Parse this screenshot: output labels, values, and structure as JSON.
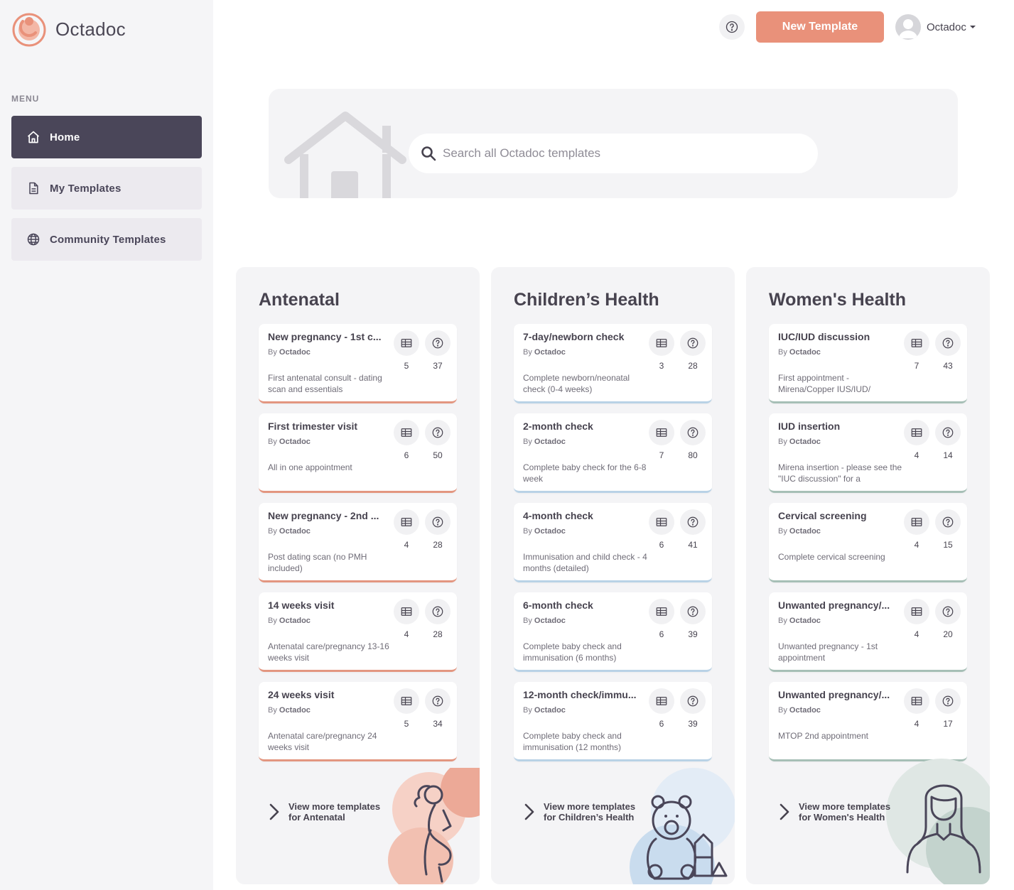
{
  "brand": {
    "name": "Octadoc",
    "accent": "#e9917a",
    "dark": "#4a4659"
  },
  "sidebar": {
    "menu_heading": "MENU",
    "items": [
      {
        "label": "Home",
        "icon": "home-icon",
        "active": true
      },
      {
        "label": "My Templates",
        "icon": "document-icon",
        "active": false
      },
      {
        "label": "Community Templates",
        "icon": "globe-icon",
        "active": false
      }
    ]
  },
  "header": {
    "help_icon": "question-circle-icon",
    "new_template_label": "New Template",
    "user_name": "Octadoc"
  },
  "search": {
    "placeholder": "Search all Octadoc templates",
    "value": ""
  },
  "columns": [
    {
      "title": "Antenatal",
      "accent": "#e39680",
      "view_more": "View more templates for Antenatal",
      "cards": [
        {
          "title": "New pregnancy - 1st c...",
          "by_prefix": "By",
          "author": "Octadoc",
          "fields": "5",
          "questions": "37",
          "desc": "First antenatal consult - dating scan and essentials"
        },
        {
          "title": "First trimester visit",
          "by_prefix": "By",
          "author": "Octadoc",
          "fields": "6",
          "questions": "50",
          "desc": "All in one appointment"
        },
        {
          "title": "New pregnancy - 2nd ...",
          "by_prefix": "By",
          "author": "Octadoc",
          "fields": "4",
          "questions": "28",
          "desc": "Post dating scan (no PMH included)"
        },
        {
          "title": "14 weeks visit",
          "by_prefix": "By",
          "author": "Octadoc",
          "fields": "4",
          "questions": "28",
          "desc": "Antenatal care/pregnancy 13-16 weeks visit"
        },
        {
          "title": "24 weeks visit",
          "by_prefix": "By",
          "author": "Octadoc",
          "fields": "5",
          "questions": "34",
          "desc": "Antenatal care/pregnancy 24 weeks visit"
        }
      ]
    },
    {
      "title": "Children’s Health",
      "accent": "#b9d2e6",
      "view_more": "View more templates for Children’s Health",
      "cards": [
        {
          "title": "7-day/newborn check",
          "by_prefix": "By",
          "author": "Octadoc",
          "fields": "3",
          "questions": "28",
          "desc": "Complete newborn/neonatal check (0-4 weeks)"
        },
        {
          "title": "2-month check",
          "by_prefix": "By",
          "author": "Octadoc",
          "fields": "7",
          "questions": "80",
          "desc": "Complete baby check for the 6-8 week"
        },
        {
          "title": "4-month check",
          "by_prefix": "By",
          "author": "Octadoc",
          "fields": "6",
          "questions": "41",
          "desc": "Immunisation and child check - 4 months (detailed)"
        },
        {
          "title": "6-month check",
          "by_prefix": "By",
          "author": "Octadoc",
          "fields": "6",
          "questions": "39",
          "desc": "Complete baby check and immunisation (6 months)"
        },
        {
          "title": "12-month check/immu...",
          "by_prefix": "By",
          "author": "Octadoc",
          "fields": "6",
          "questions": "39",
          "desc": "Complete baby check and immunisation (12 months)"
        }
      ]
    },
    {
      "title": "Women's Health",
      "accent": "#a6bfb6",
      "view_more": "View more templates for Women's Health",
      "cards": [
        {
          "title": "IUC/IUD discussion",
          "by_prefix": "By",
          "author": "Octadoc",
          "fields": "7",
          "questions": "43",
          "desc": "First appointment - Mirena/Copper IUS/IUD/"
        },
        {
          "title": "IUD insertion",
          "by_prefix": "By",
          "author": "Octadoc",
          "fields": "4",
          "questions": "14",
          "desc": "Mirena insertion - please see the \"IUC discussion\" for a"
        },
        {
          "title": "Cervical screening",
          "by_prefix": "By",
          "author": "Octadoc",
          "fields": "4",
          "questions": "15",
          "desc": "Complete cervical screening"
        },
        {
          "title": "Unwanted pregnancy/...",
          "by_prefix": "By",
          "author": "Octadoc",
          "fields": "4",
          "questions": "20",
          "desc": "Unwanted pregnancy - 1st appointment"
        },
        {
          "title": "Unwanted pregnancy/...",
          "by_prefix": "By",
          "author": "Octadoc",
          "fields": "4",
          "questions": "17",
          "desc": "MTOP 2nd appointment"
        }
      ]
    }
  ]
}
